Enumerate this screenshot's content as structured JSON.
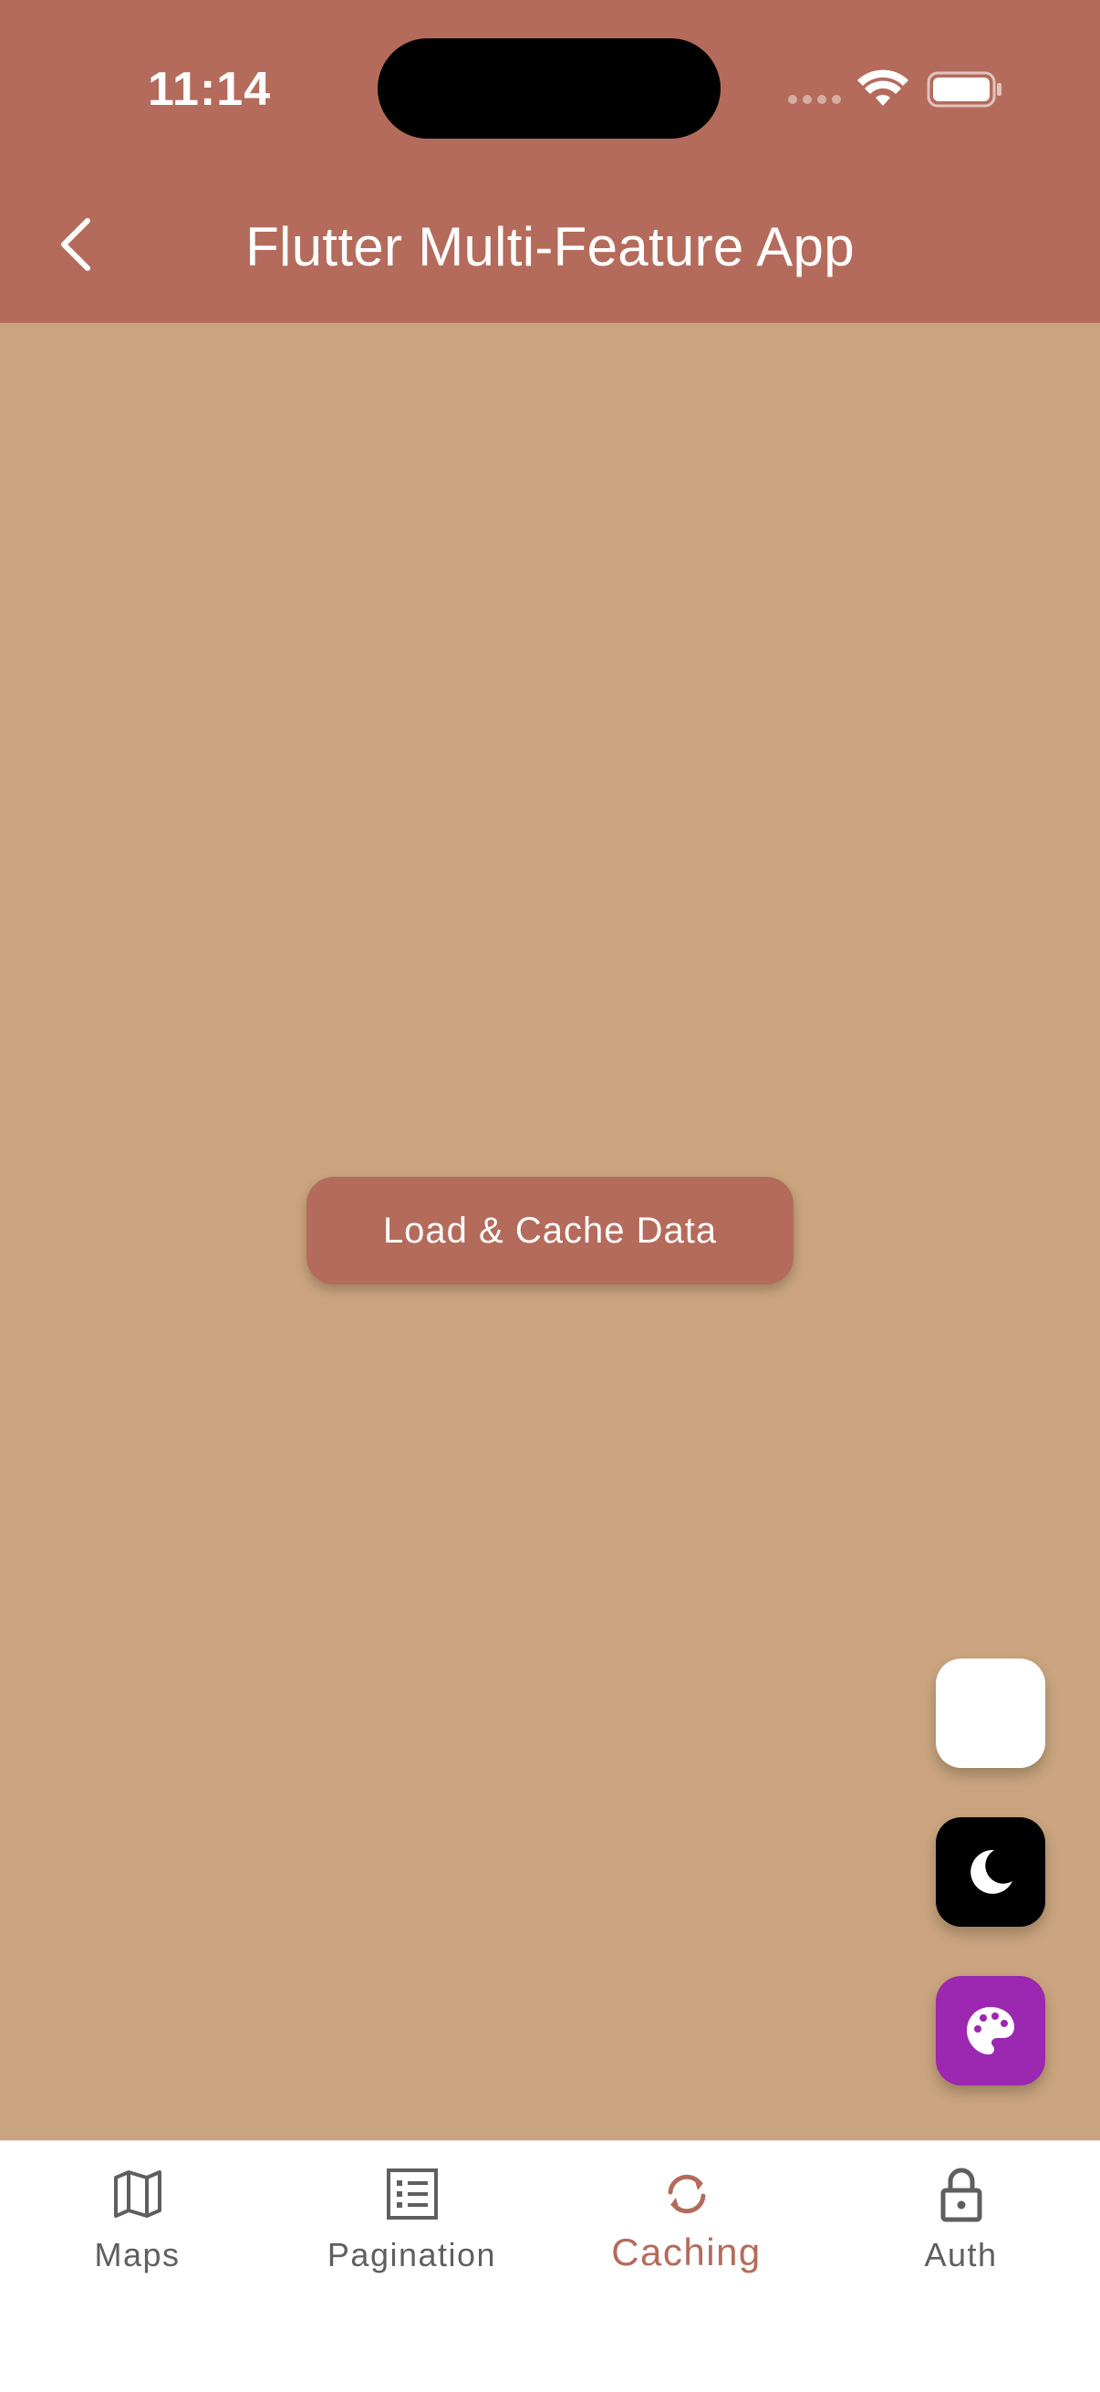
{
  "status_bar": {
    "time": "11:14"
  },
  "app_bar": {
    "title": "Flutter Multi-Feature App"
  },
  "main": {
    "load_button_label": "Load & Cache Data"
  },
  "fabs": [
    {
      "name": "blank",
      "color": "#ffffff"
    },
    {
      "name": "moon-icon",
      "color": "#000000"
    },
    {
      "name": "palette-icon",
      "color": "#9c27b0"
    }
  ],
  "bottom_nav": {
    "items": [
      {
        "label": "Maps",
        "icon": "map-icon",
        "active": false
      },
      {
        "label": "Pagination",
        "icon": "list-icon",
        "active": false
      },
      {
        "label": "Caching",
        "icon": "sync-icon",
        "active": true
      },
      {
        "label": "Auth",
        "icon": "lock-icon",
        "active": false
      }
    ]
  },
  "colors": {
    "primary": "#b46b5b",
    "background": "#c9a47e",
    "nav_inactive": "#5f5f5f"
  }
}
